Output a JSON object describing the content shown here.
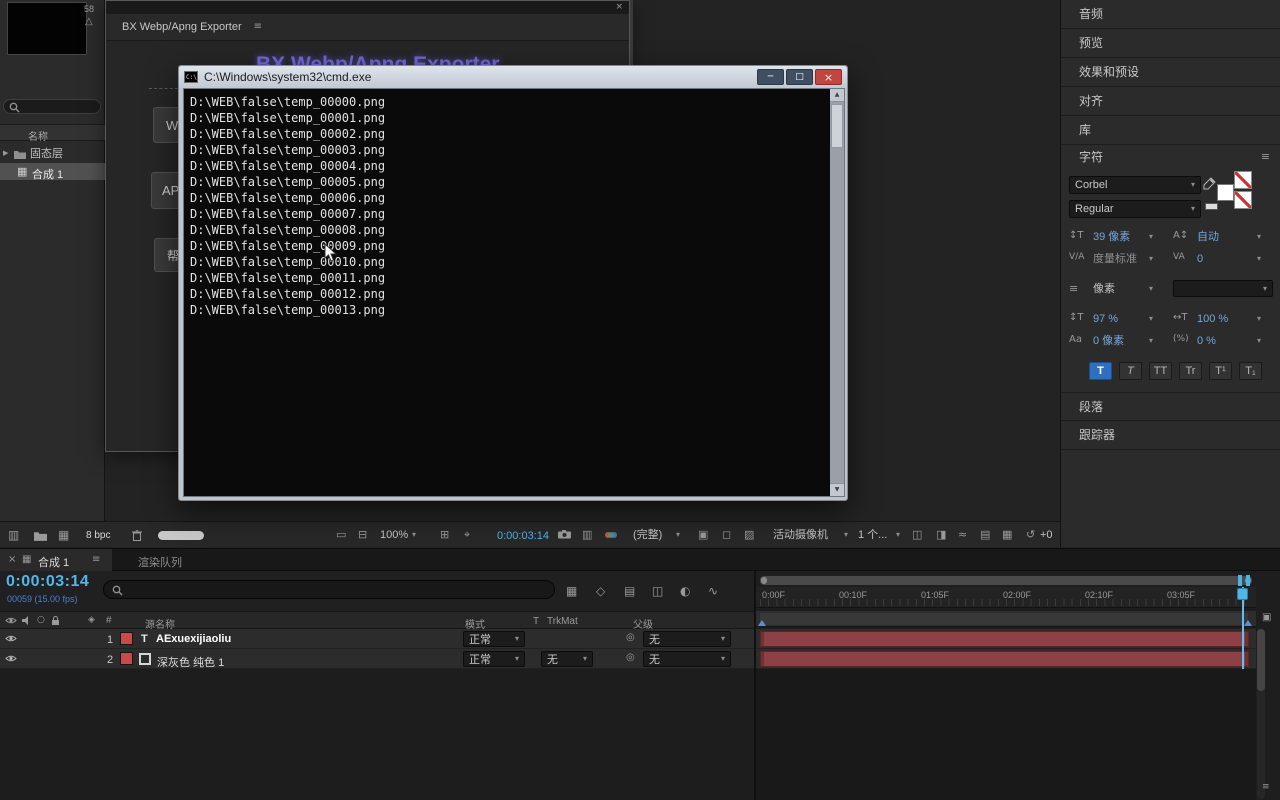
{
  "icons": {
    "caret": "▾",
    "menu": "≡",
    "close": "×",
    "win_min": "─",
    "win_max": "□",
    "win_close": "×",
    "expand_arrow": "▶",
    "warning": "△",
    "solo": "○",
    "pickwhip": "◎",
    "comp": "▦",
    "monitor": "▭",
    "monitor2": "⊟",
    "grid": "⊞",
    "safe_areas": "⌖",
    "show_snapshot": "▥",
    "resolution": "▣",
    "roi": "◻",
    "transparency_grid": "▨",
    "view_layout": "◫",
    "pixel_aspect": "◨",
    "fast_preview": "≈",
    "timeline_btn": "▤",
    "flowchart_btn": "▦",
    "exposure_reset": "↺",
    "mini_flowchart": "▦",
    "draft_3d": "◇",
    "shy": "▤",
    "frame_blend": "◫",
    "motion_blur": "◐",
    "graph_editor": "∿",
    "panel_columns": "▥",
    "tag": "◈",
    "marker": "▣",
    "arrow_up": "▲",
    "arrow_down": "▼",
    "cmd_prompt": "C:\\",
    "font_size": "↕T",
    "leading": "A↕",
    "kerning": "V/A",
    "tracking": "VA",
    "stroke_width": "≡",
    "v_scale": "↕T",
    "h_scale": "↔T",
    "baseline": "Aa",
    "tsume": "(%)"
  },
  "project_panel": {
    "thumbnail_badge": "58",
    "name_column": "名称",
    "folder_item": "固态层",
    "comp_item": "合成 1"
  },
  "script_window": {
    "menu_title": "BX Webp/Apng Exporter",
    "heading": "BX Webp/Apng Exporter",
    "button_webp": "W",
    "button_apng": "AP",
    "button_help": "帮"
  },
  "cmd_window": {
    "title": "C:\\Windows\\system32\\cmd.exe",
    "lines": [
      "D:\\WEB\\false\\temp_00000.png",
      "D:\\WEB\\false\\temp_00001.png",
      "D:\\WEB\\false\\temp_00002.png",
      "D:\\WEB\\false\\temp_00003.png",
      "D:\\WEB\\false\\temp_00004.png",
      "D:\\WEB\\false\\temp_00005.png",
      "D:\\WEB\\false\\temp_00006.png",
      "D:\\WEB\\false\\temp_00007.png",
      "D:\\WEB\\false\\temp_00008.png",
      "D:\\WEB\\false\\temp_00009.png",
      "D:\\WEB\\false\\temp_00010.png",
      "D:\\WEB\\false\\temp_00011.png",
      "D:\\WEB\\false\\temp_00012.png",
      "D:\\WEB\\false\\temp_00013.png"
    ]
  },
  "sidebar": {
    "tab_audio": "音频",
    "tab_preview": "预览",
    "tab_effects": "效果和预设",
    "tab_align": "对齐",
    "tab_libraries": "库",
    "character": {
      "title": "字符",
      "font_family": "Corbel",
      "font_style": "Regular",
      "font_size": "39 像素",
      "leading": "自动",
      "kerning": "度量标准",
      "tracking": "0",
      "stroke_unit": "像素",
      "vertical_scale": "97 %",
      "horizontal_scale": "100 %",
      "baseline_shift": "0 像素",
      "tsume": "0 %",
      "faux_bold": "T",
      "faux_italic": "T",
      "all_caps": "TT",
      "small_caps": "Tr",
      "superscript": "T¹",
      "subscript": "T₁"
    },
    "tab_paragraph": "段落",
    "tab_tracker": "跟踪器"
  },
  "project_toolbar": {
    "color_depth": "8 bpc"
  },
  "viewer_toolbar": {
    "zoom": "100%",
    "timecode": "0:00:03:14",
    "channel": "(完整)",
    "view": "活动摄像机",
    "view_layout": "1 个...",
    "exposure": "+0"
  },
  "timeline": {
    "tab_comp": "合成 1",
    "tab_render_queue": "渲染队列",
    "timecode": "0:00:03:14",
    "frame_info": "00059 (15.00 fps)",
    "col_index": "#",
    "col_source_name": "源名称",
    "col_mode": "模式",
    "col_t": "T",
    "col_trkmat": "TrkMat",
    "col_parent": "父级",
    "layers": [
      {
        "index": "1",
        "type_icon": "T",
        "name": "AExuexijiaoliu",
        "mode": "正常",
        "parent": "无"
      },
      {
        "index": "2",
        "name": "深灰色 纯色 1",
        "mode": "正常",
        "trkmat": "无",
        "parent": "无"
      }
    ],
    "ruler": [
      "0:00F",
      "00:10F",
      "01:05F",
      "02:00F",
      "02:10F",
      "03:05F"
    ]
  }
}
